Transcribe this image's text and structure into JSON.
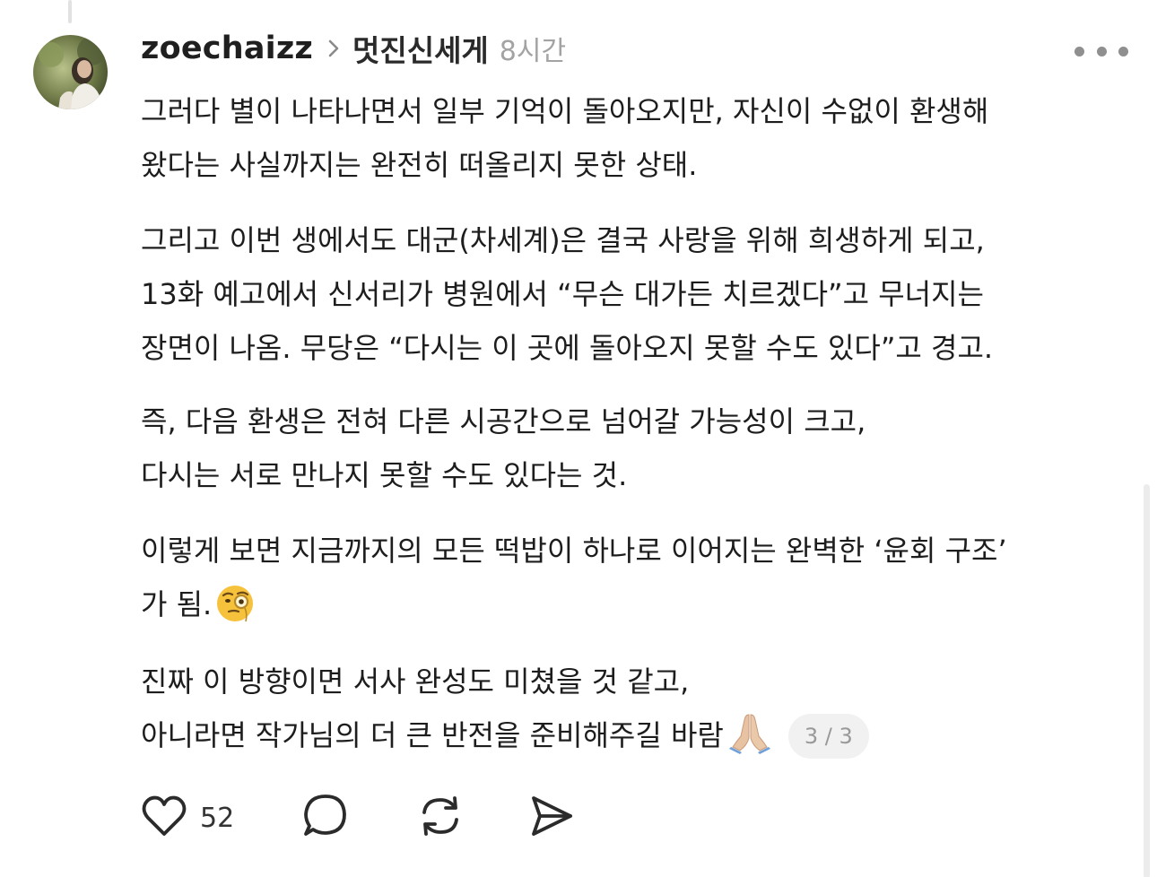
{
  "post": {
    "username": "zoechaizz",
    "topic": "멋진신세게",
    "time": "8시간",
    "paragraphs": {
      "p1": [
        "그러다 별이 나타나면서 일부 기억이 돌아오지만, 자신이 수없이 환생해",
        "왔다는 사실까지는 완전히 떠올리지 못한 상태."
      ],
      "p2": [
        "그리고 이번 생에서도 대군(차세계)은 결국 사랑을 위해 희생하게 되고,",
        "13화 예고에서 신서리가 병원에서 “무슨 대가든 치르겠다”고 무너지는",
        "장면이 나옴. 무당은 “다시는 이 곳에 돌아오지 못할 수도 있다”고 경고."
      ],
      "p3": [
        "즉, 다음 환생은 전혀 다른 시공간으로 넘어갈 가능성이 크고,",
        "다시는 서로 만나지 못할 수도 있다는 것."
      ],
      "p4": [
        "이렇게 보면 지금까지의 모든 떡밥이 하나로 이어지는 완벽한 ‘윤회 구조’",
        "가 됨."
      ],
      "p5": [
        "진짜 이 방향이면 서사 완성도 미쳤을 것 같고,",
        "아니라면 작가님의 더 큰 반전을 준비해주길 바람"
      ]
    },
    "emojis": {
      "thinking": "face-with-monocle",
      "praying": "folded-hands"
    },
    "pager": "3 / 3",
    "like_count": "52"
  }
}
